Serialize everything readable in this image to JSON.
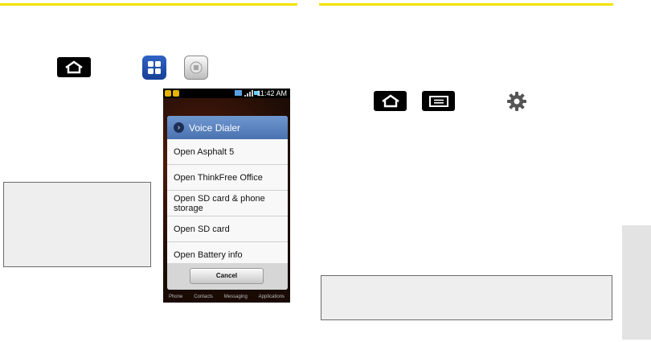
{
  "phone": {
    "status_time": "11:42 AM",
    "dialog_title": "Voice Dialer",
    "items": [
      "Open Asphalt 5",
      "Open ThinkFree Office",
      "Open SD card & phone storage",
      "Open SD card",
      "Open Battery info"
    ],
    "cancel_label": "Cancel",
    "dock": [
      "Phone",
      "Contacts",
      "Messaging",
      "Applications"
    ]
  },
  "icons": {
    "home": "home-key-icon",
    "menu": "menu-key-icon",
    "applications": "applications-icon",
    "voice_dialer": "voice-dialer-icon",
    "settings": "gear-icon"
  },
  "colors": {
    "accent_rule": "#f2e100",
    "note_bg": "#eeeeee",
    "dialog_title": "#4a72b0"
  }
}
